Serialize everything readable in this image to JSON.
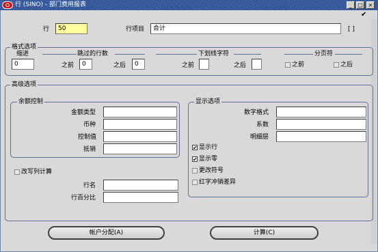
{
  "window": {
    "title": "行 (SINO) - 部门费用报表",
    "minimize_glyph": "_",
    "maximize_glyph": "□",
    "close_glyph": "×"
  },
  "header": {
    "check_mark": "✔",
    "row_label": "行",
    "row_value": "50",
    "item_label": "行项目",
    "item_value": "合计",
    "bracket_text": "[ ]"
  },
  "format": {
    "title": "格式选项",
    "indent_label": "缩进",
    "indent_value": "0",
    "skip_title": "跳过的行数",
    "before_label": "之前",
    "skip_before": "0",
    "after_label": "之后",
    "skip_after": "0",
    "underline_title": "下划线字符",
    "underline_before_label": "之前",
    "underline_before": "",
    "underline_after_label": "之后",
    "underline_after": "",
    "page_break_title": "分页符",
    "page_before_label": "之前",
    "page_after_label": "之后"
  },
  "advanced": {
    "title": "高级选项",
    "balance": {
      "title": "余额控制",
      "amount_type": "金额类型",
      "currency": "币种",
      "control_value": "控制值",
      "offset": "抵销"
    },
    "override": {
      "label": "改写列计算",
      "checked": false
    },
    "row_name_label": "行名",
    "row_percent_label": "行百分比",
    "display": {
      "title": "显示选项",
      "number_format": "数字格式",
      "factor": "系数",
      "level_of_detail": "明细层",
      "display_row": {
        "label": "显示行",
        "checked": true
      },
      "display_zero": {
        "label": "显示零",
        "checked": true
      },
      "change_sign": {
        "label": "更改符号",
        "checked": false
      },
      "red_variance": {
        "label": "红字冲销差异",
        "checked": false
      }
    }
  },
  "buttons": {
    "account_assign": "帐户分配(A)",
    "calculate": "计算(C)"
  },
  "checkbox_glyph": "✔"
}
